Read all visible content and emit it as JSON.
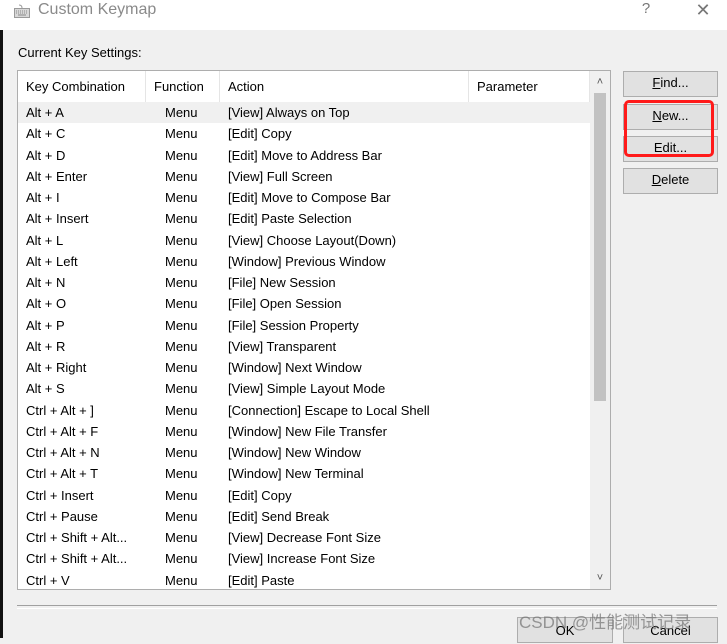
{
  "window": {
    "title": "Custom Keymap",
    "help_label": "?",
    "close_label": "✕"
  },
  "section_label": "Current Key Settings:",
  "table": {
    "columns": [
      "Key Combination",
      "Function",
      "Action",
      "Parameter"
    ],
    "selected_index": 0,
    "rows": [
      {
        "key": "Alt + A",
        "function": "Menu",
        "action": "[View] Always on Top",
        "parameter": ""
      },
      {
        "key": "Alt + C",
        "function": "Menu",
        "action": "[Edit] Copy",
        "parameter": ""
      },
      {
        "key": "Alt + D",
        "function": "Menu",
        "action": "[Edit] Move to Address Bar",
        "parameter": ""
      },
      {
        "key": "Alt + Enter",
        "function": "Menu",
        "action": "[View] Full Screen",
        "parameter": ""
      },
      {
        "key": "Alt + I",
        "function": "Menu",
        "action": "[Edit] Move to Compose Bar",
        "parameter": ""
      },
      {
        "key": "Alt + Insert",
        "function": "Menu",
        "action": "[Edit] Paste Selection",
        "parameter": ""
      },
      {
        "key": "Alt + L",
        "function": "Menu",
        "action": "[View] Choose Layout(Down)",
        "parameter": ""
      },
      {
        "key": "Alt + Left",
        "function": "Menu",
        "action": "[Window] Previous Window",
        "parameter": ""
      },
      {
        "key": "Alt + N",
        "function": "Menu",
        "action": "[File] New Session",
        "parameter": ""
      },
      {
        "key": "Alt + O",
        "function": "Menu",
        "action": "[File] Open Session",
        "parameter": ""
      },
      {
        "key": "Alt + P",
        "function": "Menu",
        "action": "[File] Session Property",
        "parameter": ""
      },
      {
        "key": "Alt + R",
        "function": "Menu",
        "action": "[View] Transparent",
        "parameter": ""
      },
      {
        "key": "Alt + Right",
        "function": "Menu",
        "action": "[Window] Next Window",
        "parameter": ""
      },
      {
        "key": "Alt + S",
        "function": "Menu",
        "action": "[View] Simple Layout Mode",
        "parameter": ""
      },
      {
        "key": "Ctrl + Alt + ]",
        "function": "Menu",
        "action": "[Connection] Escape to Local Shell",
        "parameter": ""
      },
      {
        "key": "Ctrl + Alt + F",
        "function": "Menu",
        "action": "[Window] New File Transfer",
        "parameter": ""
      },
      {
        "key": "Ctrl + Alt + N",
        "function": "Menu",
        "action": "[Window] New Window",
        "parameter": ""
      },
      {
        "key": "Ctrl + Alt + T",
        "function": "Menu",
        "action": "[Window] New Terminal",
        "parameter": ""
      },
      {
        "key": "Ctrl + Insert",
        "function": "Menu",
        "action": "[Edit] Copy",
        "parameter": ""
      },
      {
        "key": "Ctrl + Pause",
        "function": "Menu",
        "action": "[Edit] Send Break",
        "parameter": ""
      },
      {
        "key": "Ctrl + Shift + Alt...",
        "function": "Menu",
        "action": "[View] Decrease Font Size",
        "parameter": ""
      },
      {
        "key": "Ctrl + Shift + Alt...",
        "function": "Menu",
        "action": "[View] Increase Font Size",
        "parameter": ""
      },
      {
        "key": "Ctrl + V",
        "function": "Menu",
        "action": "[Edit] Paste",
        "parameter": ""
      }
    ],
    "scroll": {
      "position_fraction": 0.0,
      "visible_fraction": 0.65
    }
  },
  "buttons": {
    "find": {
      "mnemonic": "F",
      "rest": "ind..."
    },
    "new": {
      "mnemonic": "N",
      "rest": "ew..."
    },
    "edit": {
      "label": "Edit..."
    },
    "delete": {
      "mnemonic": "D",
      "rest": "elete"
    },
    "ok": "OK",
    "cancel": "Cancel"
  },
  "annotation": {
    "color": "#ff1a1a",
    "target": "New / Edit buttons"
  },
  "watermark": "CSDN @性能测试记录"
}
